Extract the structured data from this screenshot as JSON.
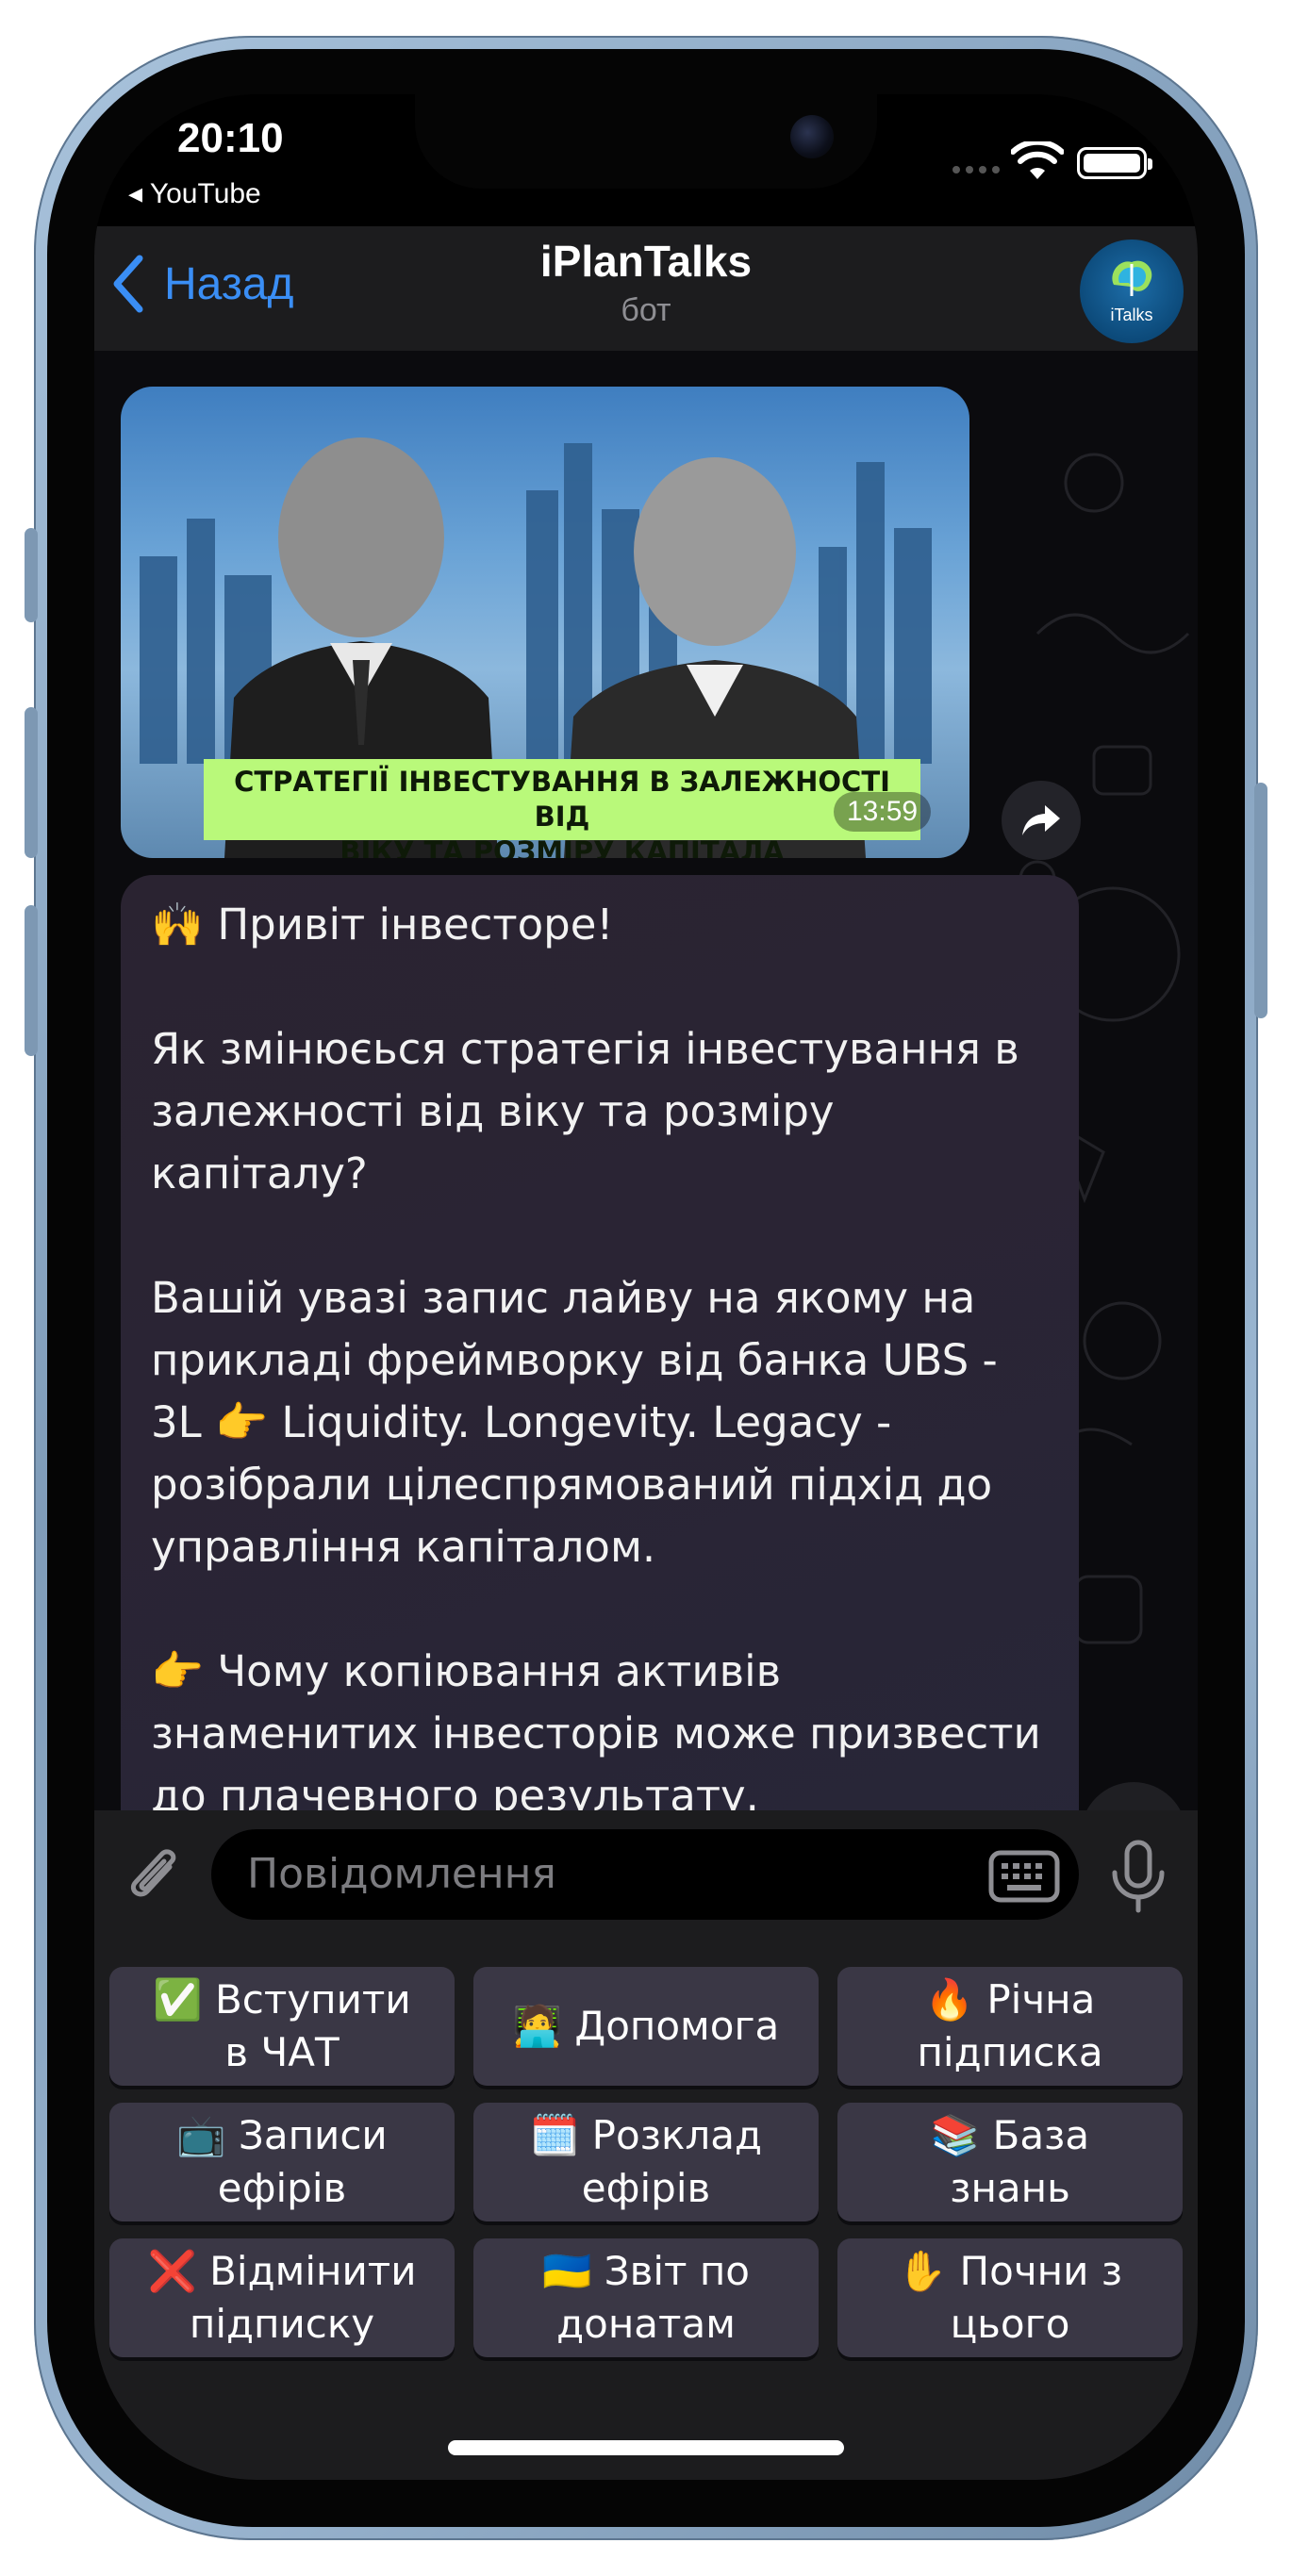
{
  "status_bar": {
    "time": "20:10",
    "back_app": "◂ YouTube"
  },
  "header": {
    "back_label": "Назад",
    "title": "iPlanTalks",
    "subtitle": "бот",
    "avatar_text": "iTalks"
  },
  "video": {
    "banner_line1": "СТРАТЕГІЇ ІНВЕСТУВАННЯ В ЗАЛЕЖНОСТІ ВІД",
    "banner_line2": "ВІКУ ТА РОЗМІРУ КАПІТАЛА",
    "duration": "13:59"
  },
  "message": {
    "greeting": "🙌 Привіт інвесторе!",
    "para1": "Як змінюєься стратегія інвестування в\nзалежності від віку та розміру\nкапіталу?",
    "para2": "Вашій увазі запис лайву на якому на\nприкладі фреймворку від банка UBS -\n3L  👉 Liquidity. Longevity. Legacy -\nрозібрали цілеспрямований підхід до\nуправління капіталом.",
    "para3": "👉 Чому копіювання активів\nзнаменитих інвесторів може призвести\nдо плачевного результату."
  },
  "input": {
    "placeholder": "Повідомлення"
  },
  "keyboard": {
    "buttons": [
      "✅ Вступити\nв ЧАТ",
      "🧑‍💻 Допомога",
      "🔥 Річна\nпідписка",
      "📺 Записи\nефірів",
      "🗓️ Розклад\nефірів",
      "📚 База\nзнань",
      "❌ Відмінити\nпідписку",
      "🇺🇦 Звіт по\nдонатам",
      "✋ Почни з\nцього"
    ]
  },
  "colors": {
    "accent": "#3a8ef5",
    "banner": "#b9f97a",
    "button_bg": "#3a3745"
  }
}
